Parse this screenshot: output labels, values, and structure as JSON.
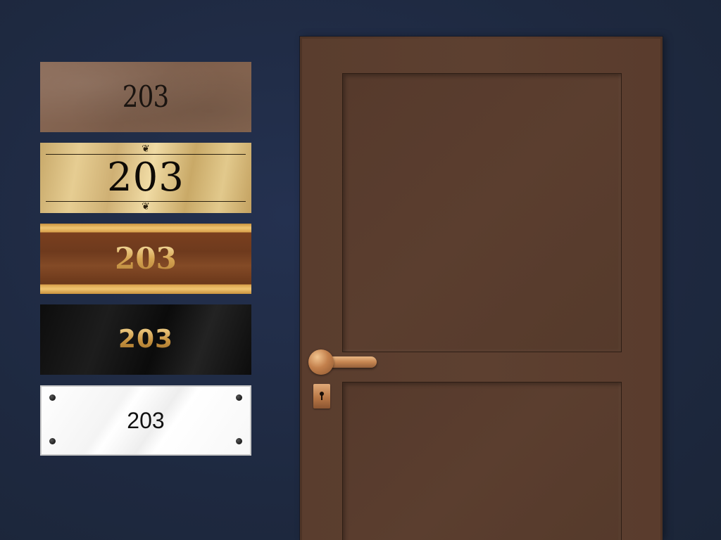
{
  "plaques": [
    {
      "style": "brown leather",
      "number": "203"
    },
    {
      "style": "brushed brass with ornaments",
      "number": "203",
      "ornament_glyph": "❦"
    },
    {
      "style": "walnut wood with gold bands",
      "number": "203"
    },
    {
      "style": "black with gold lettering",
      "number": "203"
    },
    {
      "style": "white acrylic with standoffs",
      "number": "203"
    }
  ],
  "colors": {
    "wall": "#1f2a42",
    "door": "#5a3c2d",
    "brass": "#d9bf83",
    "gold_text": "#d6a552",
    "copper_hardware": "#c3804c"
  }
}
